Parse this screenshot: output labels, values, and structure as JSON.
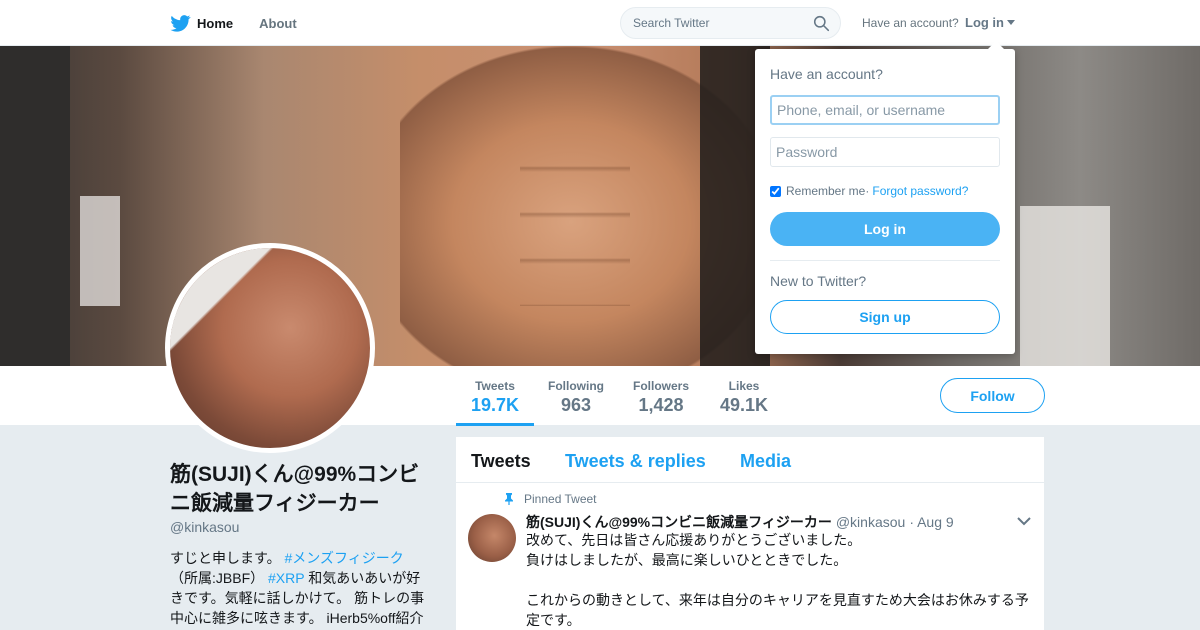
{
  "colors": {
    "accent": "#1da1f2",
    "page_bg": "#e6ecf0",
    "text": "#14171a",
    "muted": "#657786",
    "login_button": "#4ab3f4"
  },
  "topbar": {
    "home_label": "Home",
    "about_label": "About",
    "search_placeholder": "Search Twitter",
    "have_account": "Have an account?",
    "login_label": "Log in"
  },
  "profile_nav": {
    "stats": [
      {
        "label": "Tweets",
        "value": "19.7K",
        "active": true
      },
      {
        "label": "Following",
        "value": "963"
      },
      {
        "label": "Followers",
        "value": "1,428"
      },
      {
        "label": "Likes",
        "value": "49.1K"
      }
    ],
    "follow_label": "Follow"
  },
  "profile": {
    "name": "筋(SUJI)くん@99%コンビニ飯減量フィジーカー",
    "handle": "@kinkasou",
    "bio_text_1": "すじと申します。 ",
    "bio_tag_1": "#メンズフィジーク",
    "bio_text_2": "（所属:JBBF） ",
    "bio_tag_2": "#XRP",
    "bio_text_3": " 和気あいあいが好きです。気軽に話しかけて。 筋トレの事中心に雑多に呟きます。 iHerb5%off紹介"
  },
  "timeline": {
    "tabs": [
      "Tweets",
      "Tweets & replies",
      "Media"
    ],
    "pinned_label": "Pinned Tweet",
    "tweet": {
      "name": "筋(SUJI)くん@99%コンビニ飯減量フィジーカー",
      "handle": "@kinkasou",
      "date": "· Aug 9",
      "text": "改めて、先日は皆さん応援ありがとうございました。\n負けはしましたが、最高に楽しいひとときでした。\n\nこれからの動きとして、来年は自分のキャリアを見直すため大会はお休みする予定です。"
    }
  },
  "login_dropdown": {
    "title": "Have an account?",
    "username_placeholder": "Phone, email, or username",
    "password_placeholder": "Password",
    "remember_label": "Remember me",
    "separator": " · ",
    "forgot_label": "Forgot password?",
    "login_button": "Log in",
    "new_label": "New to Twitter?",
    "signup_button": "Sign up"
  }
}
